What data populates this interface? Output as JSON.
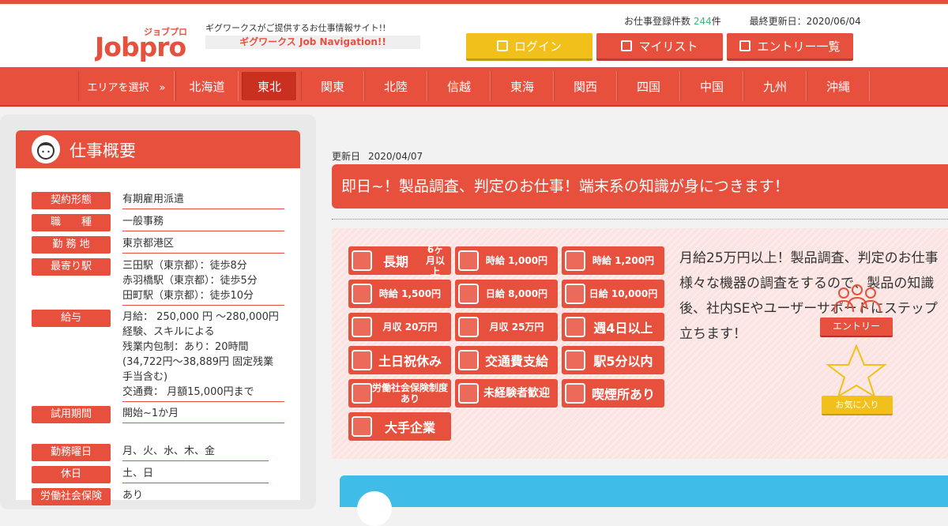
{
  "header": {
    "logo_text": "Jobpro",
    "logo_kana": "ジョブプロ",
    "tagline": "ギグワークスがご提供するお仕事情報サイト!!",
    "tagline2": "ギグワークス Job Navigation!!",
    "stats_label": "お仕事登録件数",
    "stats_count": "244",
    "stats_unit": "件",
    "updated_label": "最終更新日：2020/06/04",
    "login_label": "ログイン",
    "mylist_label": "マイリスト",
    "entry_list_label": "エントリー一覧"
  },
  "nav": {
    "area_label": "エリアを選択　»",
    "regions": [
      "北海道",
      "東北",
      "関東",
      "北陸",
      "信越",
      "東海",
      "関西",
      "四国",
      "中国",
      "九州",
      "沖縄"
    ],
    "active": "東北"
  },
  "summary": {
    "title": "仕事概要",
    "rows": [
      {
        "label": "契約形態",
        "value": "有期雇用派遣"
      },
      {
        "label": "職　　種",
        "value": "一般事務"
      },
      {
        "label": "勤 務 地",
        "value": "東京都港区"
      },
      {
        "label": "最寄り駅",
        "lines": [
          "三田駅（東京都）：徒歩8分",
          "赤羽橋駅（東京都）：徒歩5分",
          "田町駅（東京都）：徒歩10分"
        ]
      },
      {
        "label": "給与",
        "lines": [
          "月給： 250,000 円 ～280,000円",
          "経験、スキルによる",
          "残業内包制：あり：20時間",
          "(34,722円～38,889円 固定残業",
          "手当含む)",
          "交通費： 月額15,000円まで"
        ]
      },
      {
        "label": "試用期間",
        "value": "開始~1か月"
      },
      {
        "label": "勤務曜日",
        "value": "月、火、水、木、金"
      },
      {
        "label": "休日",
        "value": "土、日"
      },
      {
        "label": "労働社会保険",
        "value": "あり"
      }
    ]
  },
  "job": {
    "updated_label": "更新日",
    "updated_date": "2020/04/07",
    "title": "即日~！製品調査、判定のお仕事！端末系の知識が身につきます！",
    "description_lines": [
      "月給25万円以上！製品調査、判定のお仕事",
      "様々な機器の調査をするので、製品の知識",
      "後、社内SEやユーザーサポートにステップ",
      "立ちます！"
    ],
    "entry_label": "エントリー",
    "favorite_label": "お気に入り"
  },
  "badges": [
    {
      "text": "長期",
      "sub": "6ヶ月以上"
    },
    {
      "text": "時給 1,000円"
    },
    {
      "text": "時給 1,200円"
    },
    {
      "text": "時給 1,500円"
    },
    {
      "text": "日給 8,000円"
    },
    {
      "text": "日給 10,000円"
    },
    {
      "text": "月収 20万円"
    },
    {
      "text": "月収 25万円"
    },
    {
      "text": "週4日以上"
    },
    {
      "text": "土日祝休み"
    },
    {
      "text": "交通費支給"
    },
    {
      "text": "駅5分以内"
    },
    {
      "text": "労働社会保険制度あり"
    },
    {
      "text": "未経験者歓迎"
    },
    {
      "text": "喫煙所あり"
    },
    {
      "text": "大手企業"
    }
  ],
  "colors": {
    "brand": "#e8503e",
    "accent_yellow": "#f2c01a",
    "blue": "#3fbde8",
    "count_green": "#3cb878"
  }
}
